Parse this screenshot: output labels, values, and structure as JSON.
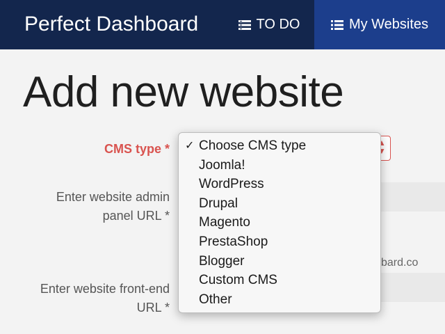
{
  "header": {
    "brand": "Perfect Dashboard",
    "nav": [
      {
        "label": "TO DO",
        "icon": "list-todo-icon"
      },
      {
        "label": "My Websites",
        "icon": "list-icon",
        "active": true
      }
    ]
  },
  "page": {
    "title": "Add new website"
  },
  "form": {
    "cms_label": "CMS type *",
    "admin_url_label": "Enter website admin panel URL *",
    "front_url_label": "Enter website front-end URL *",
    "hint_partial": "bard.co"
  },
  "dropdown": {
    "selected_index": 0,
    "check": "✓",
    "options": [
      "Choose CMS type",
      "Joomla!",
      "WordPress",
      "Drupal",
      "Magento",
      "PrestaShop",
      "Blogger",
      "Custom CMS",
      "Other"
    ]
  },
  "colors": {
    "header_bg": "#13264d",
    "active_nav_bg": "#1c3e8c",
    "required_red": "#d9534f",
    "page_bg": "#f3f3f3"
  }
}
